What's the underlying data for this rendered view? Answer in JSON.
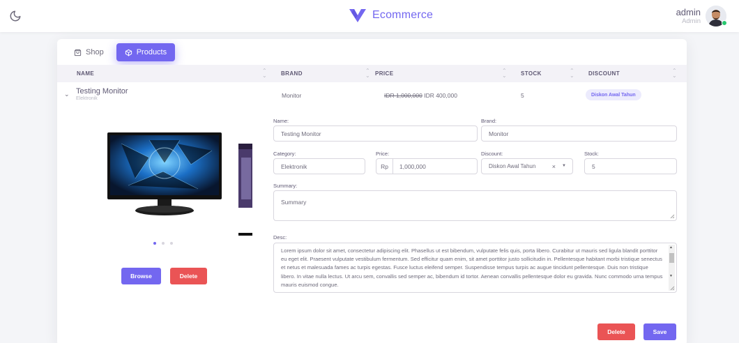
{
  "navbar": {
    "brand": "Ecommerce",
    "user_name": "admin",
    "user_role": "Admin",
    "accent": "#7367f0"
  },
  "tabs": [
    {
      "label": "Shop",
      "icon": "shopping-bag-icon"
    },
    {
      "label": "Products",
      "icon": "box-icon",
      "active": true
    }
  ],
  "table": {
    "columns": [
      "NAME",
      "BRAND",
      "PRICE",
      "STOCK",
      "DISCOUNT"
    ],
    "row": {
      "name": "Testing Monitor",
      "category": "Elektronik",
      "brand": "Monitor",
      "old_price": "IDR 1,000,000",
      "new_price": "IDR 400,000",
      "stock": "5",
      "discount": "Diskon Awal Tahun"
    }
  },
  "carousel": {
    "slides": 3,
    "active_index": 0,
    "browse_label": "Browse",
    "delete_label": "Delete"
  },
  "form": {
    "name_label": "Name:",
    "name_value": "Testing Monitor",
    "brand_label": "Brand:",
    "brand_value": "Monitor",
    "category_label": "Category:",
    "category_value": "Elektronik",
    "price_label": "Price:",
    "price_prefix": "Rp",
    "price_value": "1,000,000",
    "discount_label": "Discount:",
    "discount_value": "Diskon Awal Tahun",
    "stock_label": "Stock:",
    "stock_value": "5",
    "summary_label": "Summary:",
    "summary_placeholder": "Summary",
    "desc_label": "Desc:",
    "desc_value": "Lorem ipsum dolor sit amet, consectetur adipiscing elit. Phasellus ut est bibendum, vulputate felis quis, porta libero. Curabitur ut mauris sed ligula blandit porttitor eu eget elit. Praesent vulputate vestibulum fermentum. Sed efficitur quam enim, sit amet porttitor justo sollicitudin in. Pellentesque habitant morbi tristique senectus et netus et malesuada fames ac turpis egestas. Fusce luctus eleifend semper. Suspendisse tempus turpis ac augue tincidunt pellentesque. Duis non tristique libero. In vitae nulla lectus. Ut arcu sem, convallis sed semper ac, bibendum id tortor. Aenean convallis pellentesque dolor eu gravida. Nunc commodo urna tempus mauris euismod congue.",
    "delete_label": "Delete",
    "save_label": "Save"
  }
}
